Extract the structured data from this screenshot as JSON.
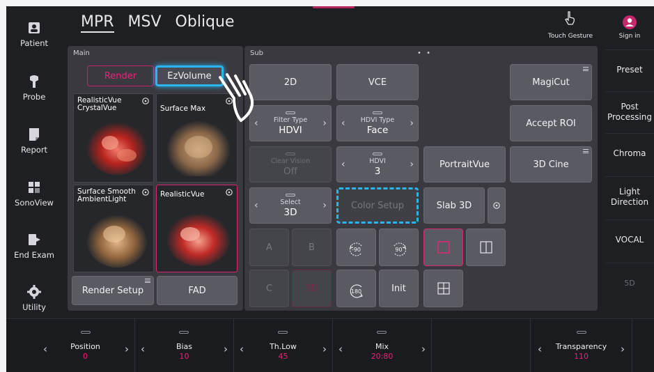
{
  "left_nav": [
    {
      "label": "Patient",
      "icon": "patient-icon"
    },
    {
      "label": "Probe",
      "icon": "probe-icon"
    },
    {
      "label": "Report",
      "icon": "report-icon"
    },
    {
      "label": "SonoView",
      "icon": "sonoview-icon"
    },
    {
      "label": "End Exam",
      "icon": "end-exam-icon"
    },
    {
      "label": "Utility",
      "icon": "gear-icon"
    }
  ],
  "tabs": [
    "MPR",
    "MSV",
    "Oblique"
  ],
  "touch_gesture": "Touch Gesture",
  "sign_in": "Sign in",
  "right_nav": [
    "Preset",
    "Post Processing",
    "Chroma",
    "Light Direction",
    "VOCAL",
    "5D"
  ],
  "main": {
    "title": "Main",
    "render": "Render",
    "ezvolume": "EzVolume",
    "thumbs": [
      {
        "label1": "RealisticVue",
        "label2": "CrystalVue"
      },
      {
        "label1": "Surface Max",
        "label2": ""
      },
      {
        "label1": "Surface Smooth",
        "label2": "AmbientLight"
      },
      {
        "label1": "RealisticVue",
        "label2": ""
      }
    ],
    "render_setup": "Render Setup",
    "fad": "FAD"
  },
  "sub": {
    "title": "Sub",
    "dots": "• •",
    "b2d": "2D",
    "vce": "VCE",
    "magicut": "MagiCut",
    "filter_type": {
      "cap": "Filter Type",
      "val": "HDVI"
    },
    "hdvi_type": {
      "cap": "HDVI Type",
      "val": "Face"
    },
    "accept_roi": "Accept ROI",
    "clear_vision": {
      "cap": "Clear Vision",
      "val": "Off"
    },
    "hdvi": {
      "cap": "HDVI",
      "val": "3"
    },
    "portraitvue": "PortraitVue",
    "cine3d": "3D Cine",
    "select": {
      "cap": "Select",
      "val": "3D"
    },
    "color_setup": "Color Setup",
    "slab3d": "Slab 3D",
    "a": "A",
    "b": "B",
    "c": "C",
    "d3": "3D",
    "rot_m90": "-90",
    "rot_90": "90",
    "rot_180": "180",
    "init": "Init"
  },
  "bottom": [
    {
      "cap": "Position",
      "val": "0"
    },
    {
      "cap": "Bias",
      "val": "10"
    },
    {
      "cap": "Th.Low",
      "val": "45"
    },
    {
      "cap": "Mix",
      "val": "20:80"
    },
    {
      "cap": "Transparency",
      "val": "110"
    }
  ],
  "colors": {
    "accent": "#e8247a",
    "highlight": "#2bb5f0",
    "background": "#1e1f23",
    "button": "#5a5b62"
  }
}
